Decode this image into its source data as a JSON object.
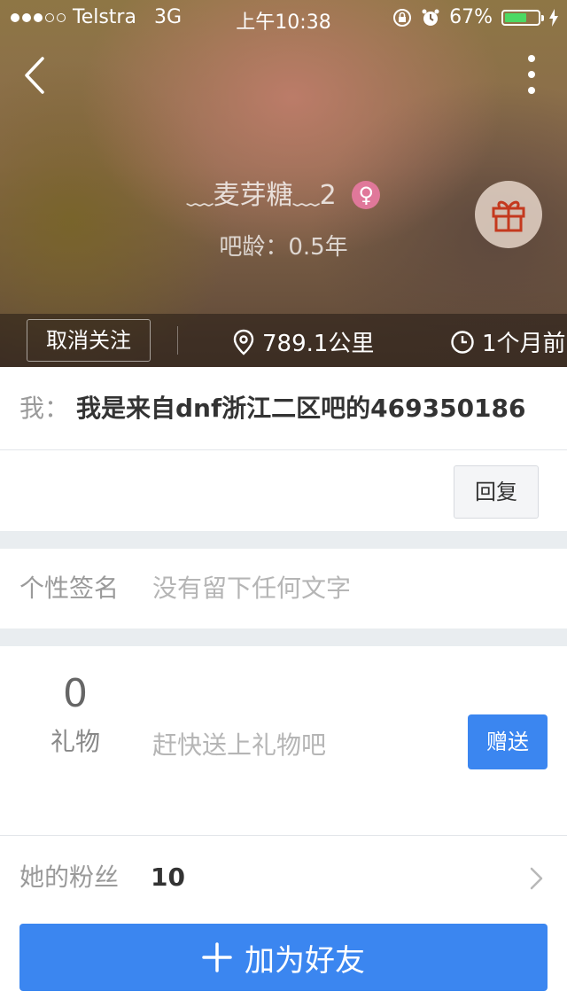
{
  "status_bar": {
    "carrier": "Telstra",
    "network": "3G",
    "time": "上午10:38",
    "battery_percent": "67%",
    "battery_level": 0.67,
    "battery_color": "#4cd964"
  },
  "header": {
    "username": "﹏麦芽糖﹏2",
    "gender_symbol": "♀",
    "tieba_age": "吧龄：0.5年",
    "unfollow_label": "取消关注",
    "distance": "789.1公里",
    "last_active": "1个月前",
    "icons": [
      "back-icon",
      "more-icon",
      "gift-icon",
      "location-pin-icon",
      "clock-icon"
    ]
  },
  "message": {
    "label": "我：",
    "text": "我是来自dnf浙江二区吧的469350186",
    "reply_label": "回复"
  },
  "signature": {
    "label": "个性签名",
    "text": "没有留下任何文字"
  },
  "gifts": {
    "count": "0",
    "label": "礼物",
    "prompt": "赶快送上礼物吧",
    "send_label": "赠送"
  },
  "fans": {
    "label": "她的粉丝",
    "count": "10"
  },
  "add_friend": {
    "icon": "plus-icon",
    "label": "加为好友"
  },
  "colors": {
    "accent": "#3b86f0",
    "gender_badge": "#e0789a",
    "gift_icon": "#c4391e",
    "section_gap": "#e9edf0"
  }
}
